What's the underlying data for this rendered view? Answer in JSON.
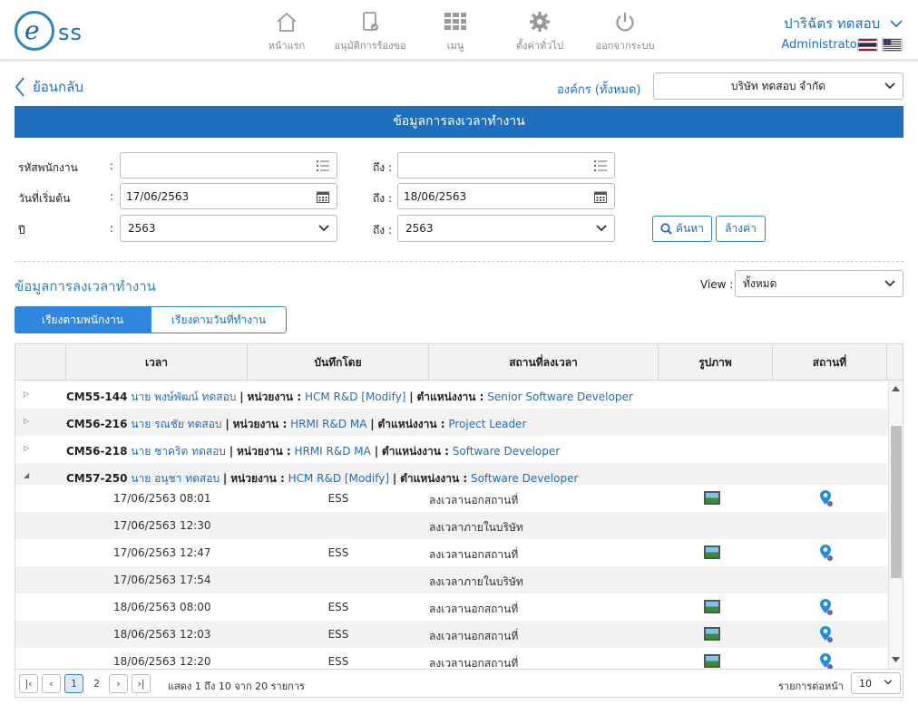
{
  "header": {
    "logo_text": "ss",
    "nav": [
      {
        "label": "หน้าแรก",
        "icon": "home-icon"
      },
      {
        "label": "อนุมัติการร้องขอ",
        "icon": "approve-document-icon"
      },
      {
        "label": "เมนู",
        "icon": "menu-grid-icon"
      },
      {
        "label": "ตั้งค่าทั่วไป",
        "icon": "gear-icon"
      },
      {
        "label": "ออกจากระบบ",
        "icon": "power-icon"
      }
    ],
    "user_name": "ปาริฉัตร ทดสอบ",
    "role": "Administrator",
    "flags": [
      "thai-flag-icon",
      "us-flag-icon"
    ]
  },
  "toolbar": {
    "back_label": "ย้อนกลับ",
    "org_label": "องค์กร (ทั้งหมด)",
    "org_value": "บริษัท ทดสอบ จำกัด"
  },
  "banner_title": "ข้อมูลการลงเวลาทำงาน",
  "filters": {
    "employee_label": "รหัสพนักงาน",
    "employee_value": "",
    "to_label": "ถึง :",
    "employee_to_value": "",
    "start_date_label": "วันที่เริ่มต้น",
    "start_date_value": "17/06/2563",
    "end_date_value": "18/06/2563",
    "year_label": "ปี",
    "year_value": "2563",
    "year_to_value": "2563",
    "colon": ":",
    "search_label": "ค้นหา",
    "clear_label": "ล้างค่า"
  },
  "section_title": "ข้อมูลการลงเวลาทำงาน",
  "view": {
    "label": "View :",
    "value": "ทั้งหมด"
  },
  "tabs": [
    {
      "label": "เรียงตามพนักงาน",
      "active": true
    },
    {
      "label": "เรียงตามวันที่ทำงาน",
      "active": false
    }
  ],
  "table": {
    "columns": [
      "เวลา",
      "บันทึกโดย",
      "สถานที่ลงเวลา",
      "รูปภาพ",
      "สถานที่"
    ],
    "groups": [
      {
        "code": "CM55-144",
        "name": "นาย พงษ์พัฒน์ ทดสอบ",
        "unit_label": "หน่วยงาน :",
        "unit": "HCM R&D [Modify]",
        "pos_label": "ตำแหน่งงาน :",
        "position": "Senior Software Developer",
        "expanded": false
      },
      {
        "code": "CM56-216",
        "name": "นาย รณชัย ทดสอบ",
        "unit_label": "หน่วยงาน :",
        "unit": "HRMI R&D MA",
        "pos_label": "ตำแหน่งงาน :",
        "position": "Project Leader",
        "expanded": false
      },
      {
        "code": "CM56-218",
        "name": "นาย ชาคริต ทดสอบ",
        "unit_label": "หน่วยงาน :",
        "unit": "HRMI R&D MA",
        "pos_label": "ตำแหน่งงาน :",
        "position": "Software Developer",
        "expanded": false
      },
      {
        "code": "CM57-250",
        "name": "นาย อนุชา ทดสอบ",
        "unit_label": "หน่วยงาน :",
        "unit": "HCM R&D [Modify]",
        "pos_label": "ตำแหน่งงาน :",
        "position": "Software Developer",
        "expanded": true
      }
    ],
    "rows": [
      {
        "time": "17/06/2563 08:01",
        "by": "ESS",
        "place": "ลงเวลานอกสถานที่",
        "photo": true,
        "map": true
      },
      {
        "time": "17/06/2563 12:30",
        "by": "",
        "place": "ลงเวลาภายในบริษัท",
        "photo": false,
        "map": false
      },
      {
        "time": "17/06/2563 12:47",
        "by": "ESS",
        "place": "ลงเวลานอกสถานที่",
        "photo": true,
        "map": true
      },
      {
        "time": "17/06/2563 17:54",
        "by": "",
        "place": "ลงเวลาภายในบริษัท",
        "photo": false,
        "map": false
      },
      {
        "time": "18/06/2563 08:00",
        "by": "ESS",
        "place": "ลงเวลานอกสถานที่",
        "photo": true,
        "map": true
      },
      {
        "time": "18/06/2563 12:03",
        "by": "ESS",
        "place": "ลงเวลานอกสถานที่",
        "photo": true,
        "map": true
      },
      {
        "time": "18/06/2563 12:20",
        "by": "ESS",
        "place": "ลงเวลานอกสถานที่",
        "photo": true,
        "map": true
      }
    ]
  },
  "pager": {
    "pages": [
      "1",
      "2"
    ],
    "current": "1",
    "summary": "แสดง 1 ถึง 10 จาก 20 รายการ",
    "per_page_label": "รายการต่อหน้า",
    "per_page": "10"
  },
  "colors": {
    "primary": "#1f6fbf",
    "link": "#1f6fc0",
    "row_alt": "#f2f2f2"
  }
}
